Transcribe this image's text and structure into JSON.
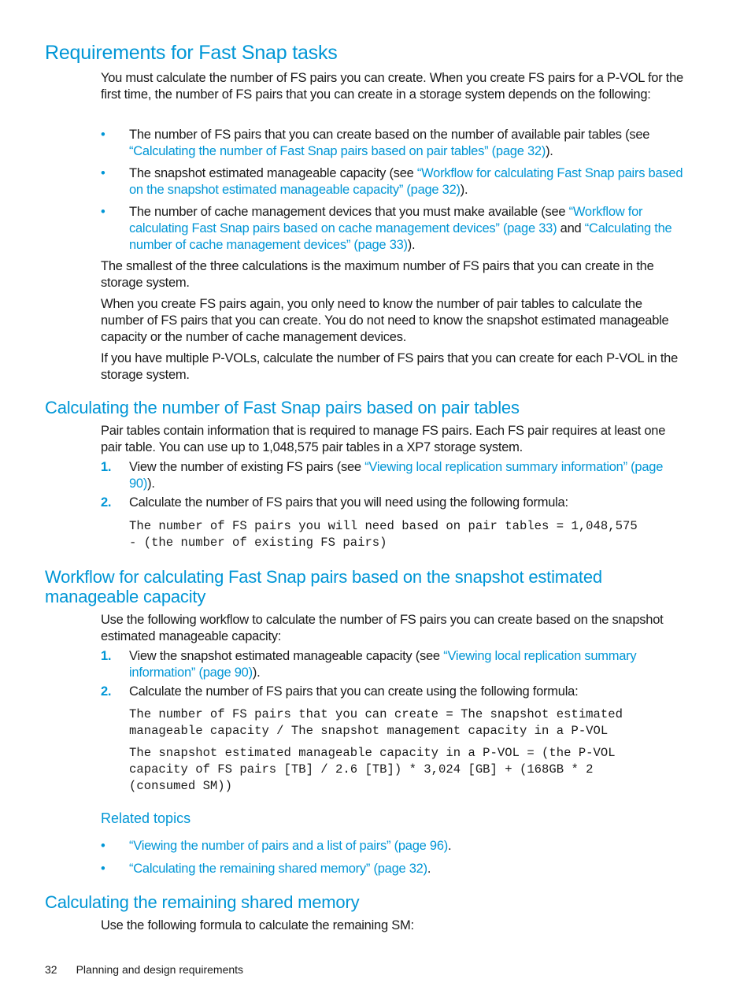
{
  "section1": {
    "title": "Requirements for Fast Snap tasks",
    "intro": "You must calculate the number of FS pairs you can create. When you create FS pairs for a P-VOL for the first time, the number of FS pairs that you can create in a storage system depends on the following:",
    "bullets": [
      {
        "pre": "The number of FS pairs that you can create based on the number of available pair tables (see ",
        "link": "“Calculating the number of Fast Snap pairs based on pair tables” (page 32)",
        "post": ")."
      },
      {
        "pre": "The snapshot estimated manageable capacity (see ",
        "link": "“Workflow for calculating Fast Snap pairs based on the snapshot estimated manageable capacity” (page 32)",
        "post": ")."
      },
      {
        "pre": "The number of cache management devices that you must make available (see ",
        "link": "“Workflow for calculating Fast Snap pairs based on cache management devices” (page 33)",
        "mid": " and ",
        "link2": "“Calculating the number of cache management devices” (page 33)",
        "post": ")."
      }
    ],
    "para2": "The smallest of the three calculations is the maximum number of FS pairs that you can create in the storage system.",
    "para3": "When you create FS pairs again, you only need to know the number of pair tables to calculate the number of FS pairs that you can create. You do not need to know the snapshot estimated manageable capacity or the number of cache management devices.",
    "para4": "If you have multiple P-VOLs, calculate the number of FS pairs that you can create for each P-VOL in the storage system."
  },
  "section2": {
    "title": "Calculating the number of Fast Snap pairs based on pair tables",
    "intro": "Pair tables contain information that is required to manage FS pairs. Each FS pair requires at least one pair table. You can use up to 1,048,575 pair tables in a XP7 storage system.",
    "steps": [
      {
        "num": "1.",
        "pre": "View the number of existing FS pairs (see ",
        "link": "“Viewing local replication summary information” (page 90)",
        "post": ")."
      },
      {
        "num": "2.",
        "pre": "Calculate the number of FS pairs that you will need using the following formula:"
      }
    ],
    "formula": "The number of FS pairs you will need based on pair tables = 1,048,575\n- (the number of existing FS pairs)"
  },
  "section3": {
    "title_line1": "Workflow for calculating Fast Snap pairs based on the snapshot estimated",
    "title_line2": "manageable capacity",
    "intro": "Use the following workflow to calculate the number of FS pairs you can create based on the snapshot estimated manageable capacity:",
    "steps": [
      {
        "num": "1.",
        "pre": "View the snapshot estimated manageable capacity (see ",
        "link": "“Viewing local replication summary information” (page 90)",
        "post": ")."
      },
      {
        "num": "2.",
        "pre": "Calculate the number of FS pairs that you can create using the following formula:"
      }
    ],
    "formula1": "The number of FS pairs that you can create = The snapshot estimated\nmanageable capacity / The snapshot management capacity in a P-VOL",
    "formula2": "The snapshot estimated manageable capacity in a P-VOL = (the P-VOL\ncapacity of FS pairs [TB] / 2.6 [TB]) * 3,024 [GB] + (168GB * 2\n(consumed SM))",
    "related_title": "Related topics",
    "related": [
      {
        "link": "“Viewing the number of pairs and a list of pairs” (page 96)",
        "post": "."
      },
      {
        "link": "“Calculating the remaining shared memory” (page 32)",
        "post": "."
      }
    ]
  },
  "section4": {
    "title": "Calculating the remaining shared memory",
    "intro": "Use the following formula to calculate the remaining SM:"
  },
  "footer": {
    "page_number": "32",
    "chapter": "Planning and design requirements"
  }
}
